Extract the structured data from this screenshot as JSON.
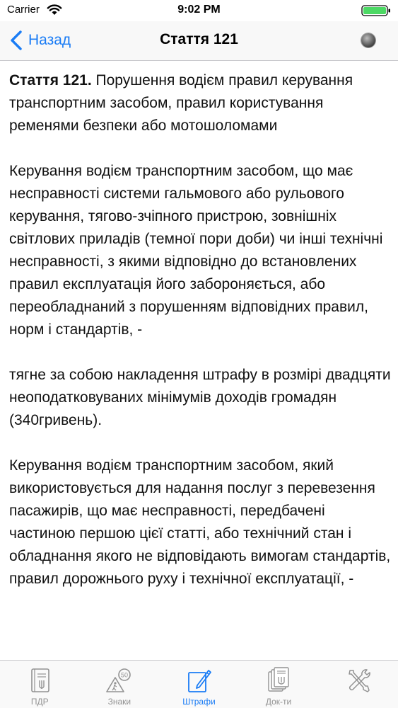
{
  "status_bar": {
    "carrier": "Carrier",
    "time": "9:02 PM"
  },
  "nav": {
    "back_label": "Назад",
    "title": "Стаття 121"
  },
  "article": {
    "number": "Стаття 121.",
    "heading": " Порушення водієм правил керування транспортним засобом, правил користування ременями безпеки або мотошоломами",
    "paragraphs": [
      "Керування водієм транспортним засобом, що має несправності системи гальмового або рульового керування, тягово-зчіпного пристрою, зовнішніх світлових приладів (темної пори доби) чи інші технічні несправності, з якими відповідно до встановлених правил експлуатація його забороняється, або переобладнаний з порушенням відповідних правил, норм і стандартів, -",
      "тягне за собою накладення штрафу в розмірі двадцяти неоподатковуваних мінімумів доходів громадян (340гривень).",
      "Керування водієм транспортним засобом, який використовується для надання послуг з перевезення пасажирів, що має несправності, передбачені частиною першою цієї статті, або технічний стан і обладнання якого не відповідають вимогам стандартів, правил дорожнього руху і технічної експлуатації, -"
    ]
  },
  "tabs": [
    {
      "label": "ПДР",
      "icon": "rules-book-icon",
      "active": false
    },
    {
      "label": "Знаки",
      "icon": "road-signs-icon",
      "active": false
    },
    {
      "label": "Штрафи",
      "icon": "fines-pencil-icon",
      "active": true
    },
    {
      "label": "Док-ти",
      "icon": "documents-icon",
      "active": false
    },
    {
      "label": "",
      "icon": "tools-icon",
      "active": false
    }
  ],
  "colors": {
    "accent": "#1a7cf5",
    "inactive_tab": "#929292"
  },
  "tab_badge": "50"
}
